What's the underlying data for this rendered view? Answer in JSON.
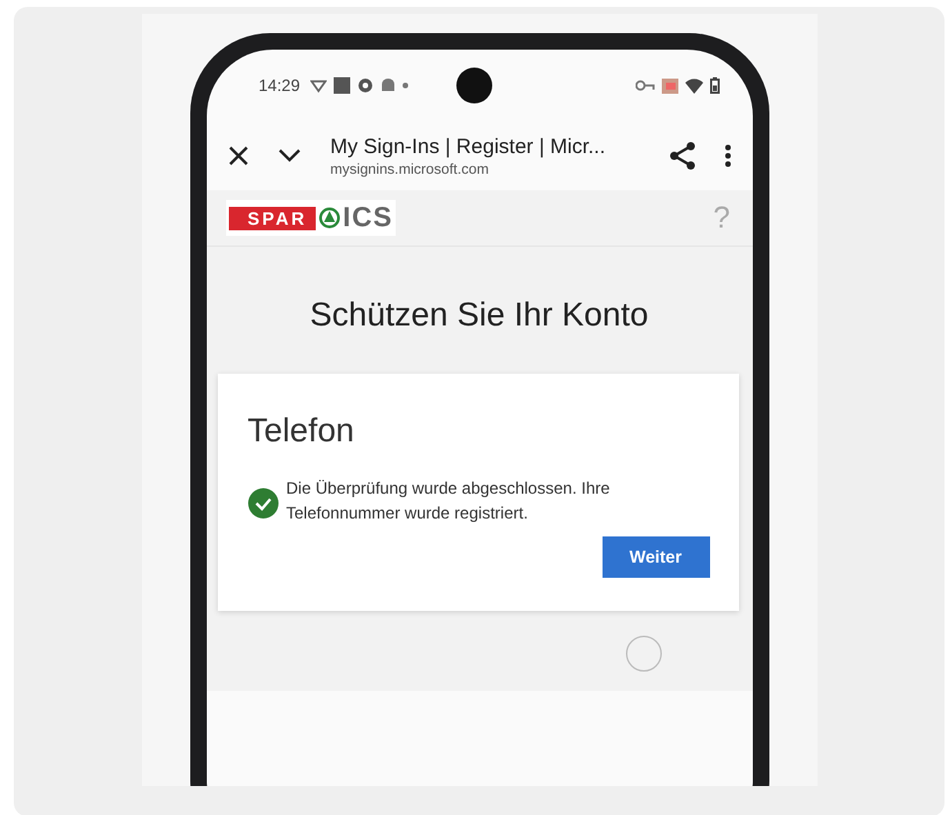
{
  "status_bar": {
    "time": "14:29"
  },
  "browser_bar": {
    "title": "My Sign-Ins | Register | Micr...",
    "url": "mysignins.microsoft.com"
  },
  "header": {
    "logo_left": "SPAR",
    "logo_right": "ICS",
    "help": "?"
  },
  "page": {
    "heading": "Schützen Sie Ihr Konto"
  },
  "card": {
    "title": "Telefon",
    "message": "Die Überprüfung wurde abgeschlossen. Ihre Telefonnummer wurde registriert.",
    "button": "Weiter"
  }
}
